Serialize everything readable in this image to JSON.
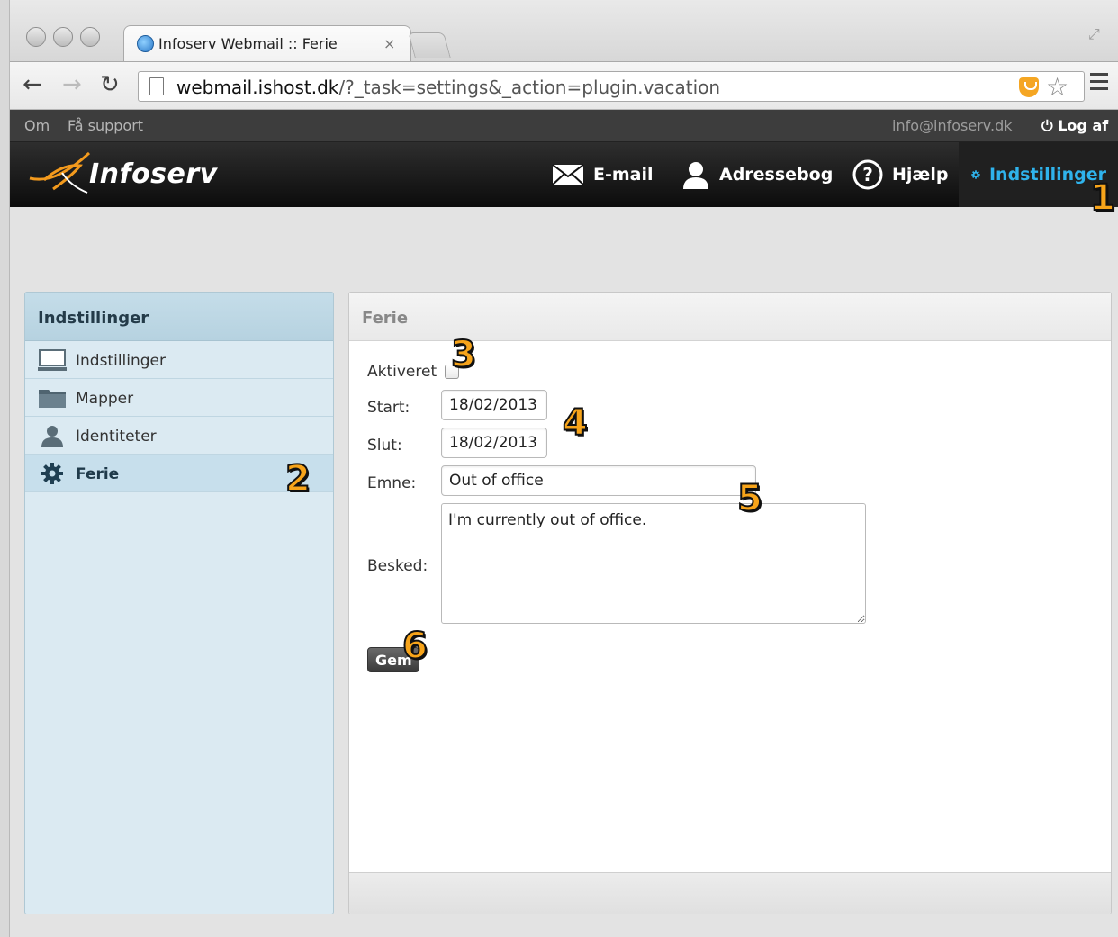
{
  "browser": {
    "tab_title": "Infoserv Webmail :: Ferie",
    "tab_close": "×",
    "url_host": "webmail.ishost.dk",
    "url_path": "/?_task=settings&_action=plugin.vacation"
  },
  "topline": {
    "about": "Om",
    "support": "Få support",
    "user_email": "info@infoserv.dk",
    "logout": "Log af",
    "logout_glyph": "⏻"
  },
  "header": {
    "logo": "Infoserv",
    "nav": {
      "email": "E-mail",
      "addressbook": "Adressebog",
      "help": "Hjælp",
      "settings": "Indstillinger"
    },
    "active_color": "#2fb3ec"
  },
  "sidebar": {
    "title": "Indstillinger",
    "items": [
      {
        "label": "Indstillinger",
        "icon": "monitor-icon"
      },
      {
        "label": "Mapper",
        "icon": "folder-icon"
      },
      {
        "label": "Identiteter",
        "icon": "person-icon"
      },
      {
        "label": "Ferie",
        "icon": "gear-icon",
        "selected": true
      }
    ]
  },
  "vacation_form": {
    "title": "Ferie",
    "enabled_label": "Aktiveret",
    "enabled": false,
    "start_label": "Start:",
    "start_value": "18/02/2013",
    "end_label": "Slut:",
    "end_value": "18/02/2013",
    "subject_label": "Emne:",
    "subject_value": "Out of office",
    "message_label": "Besked:",
    "message_value": "I'm currently out of office.",
    "save_label": "Gem"
  },
  "annotations": [
    "1",
    "2",
    "3",
    "4",
    "5",
    "6"
  ]
}
